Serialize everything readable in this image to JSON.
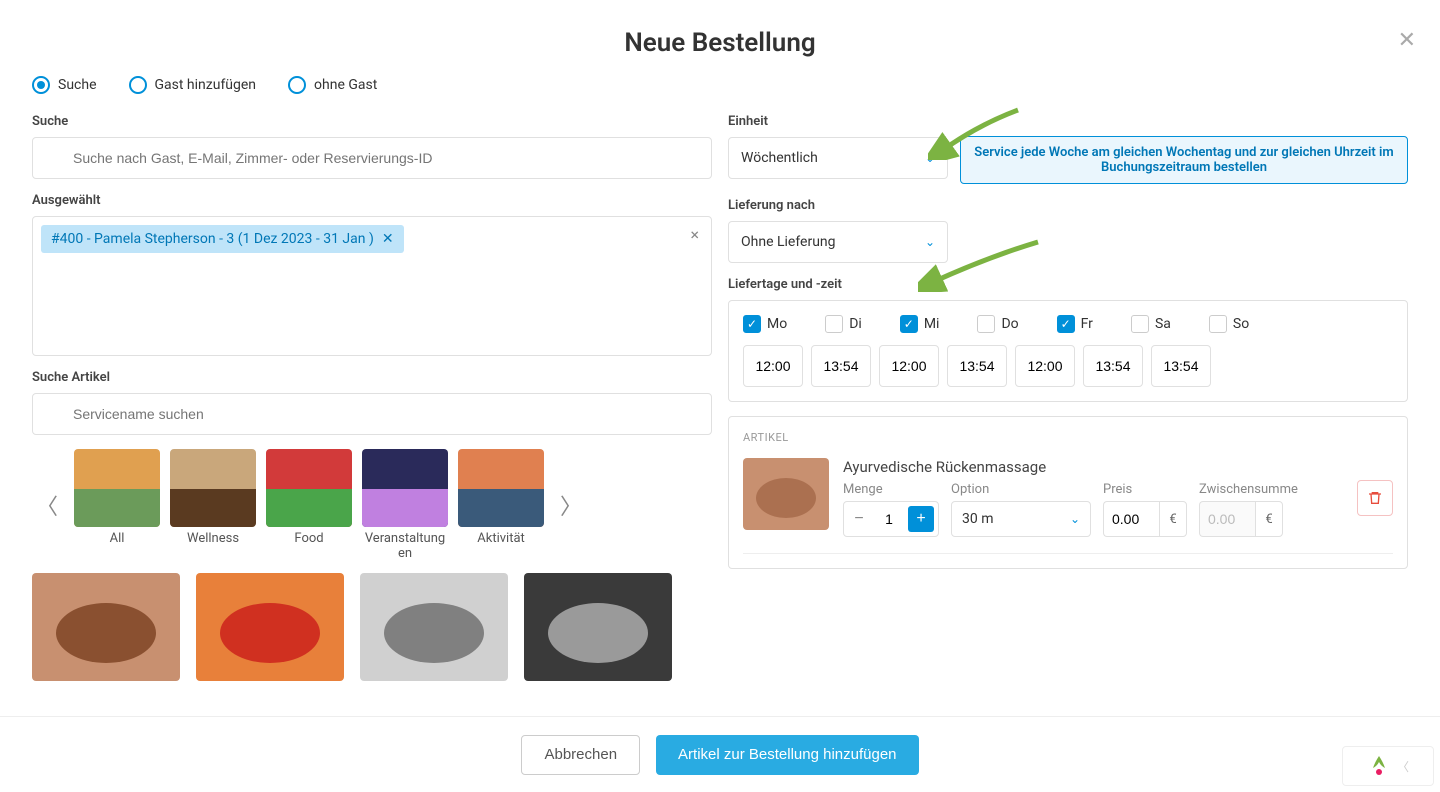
{
  "title": "Neue Bestellung",
  "radios": {
    "search": "Suche",
    "addGuest": "Gast hinzufügen",
    "noGuest": "ohne Gast"
  },
  "labels": {
    "search": "Suche",
    "selected": "Ausgewählt",
    "searchArticle": "Suche Artikel",
    "unit": "Einheit",
    "deliveryAfter": "Lieferung nach",
    "deliveryDaysTime": "Liefertage und -zeit",
    "article": "ARTIKEL",
    "qty": "Menge",
    "option": "Option",
    "price": "Preis",
    "subtotal": "Zwischensumme"
  },
  "placeholders": {
    "search": "Suche nach Gast, E-Mail, Zimmer- oder Reservierungs-ID",
    "searchArticle": "Servicename suchen"
  },
  "chip": "#400 - Pamela Stepherson - 3 (1 Dez 2023 - 31 Jan )",
  "unitValue": "Wöchentlich",
  "deliveryValue": "Ohne Lieferung",
  "hint": "Service jede Woche am gleichen Wochentag und zur gleichen Uhrzeit im Buchungszeitraum bestellen",
  "days": [
    {
      "label": "Mo",
      "checked": true
    },
    {
      "label": "Di",
      "checked": false
    },
    {
      "label": "Mi",
      "checked": true
    },
    {
      "label": "Do",
      "checked": false
    },
    {
      "label": "Fr",
      "checked": true
    },
    {
      "label": "Sa",
      "checked": false
    },
    {
      "label": "So",
      "checked": false
    }
  ],
  "times": [
    "12:00",
    "13:54",
    "12:00",
    "13:54",
    "12:00",
    "13:54",
    "13:54"
  ],
  "categories": [
    {
      "label": "All",
      "color1": "#e0a050",
      "color2": "#6b9b5a"
    },
    {
      "label": "Wellness",
      "color1": "#c9a77b",
      "color2": "#5a3a20"
    },
    {
      "label": "Food",
      "color1": "#d23a3a",
      "color2": "#4aa54a"
    },
    {
      "label": "Veranstaltungen",
      "color1": "#2a2a5a",
      "color2": "#c080e0"
    },
    {
      "label": "Aktivität",
      "color1": "#e08050",
      "color2": "#3a5a7a"
    }
  ],
  "products": [
    {
      "color1": "#c89070",
      "color2": "#8a5030"
    },
    {
      "color1": "#e8803a",
      "color2": "#d03020"
    },
    {
      "color1": "#d0d0d0",
      "color2": "#808080"
    },
    {
      "color1": "#3a3a3a",
      "color2": "#9a9a9a"
    }
  ],
  "articleItem": {
    "title": "Ayurvedische Rückenmassage",
    "qty": "1",
    "option": "30 m",
    "price": "0.00",
    "currency": "€",
    "subtotal": "0.00"
  },
  "buttons": {
    "cancel": "Abbrechen",
    "add": "Artikel zur Bestellung hinzufügen"
  }
}
